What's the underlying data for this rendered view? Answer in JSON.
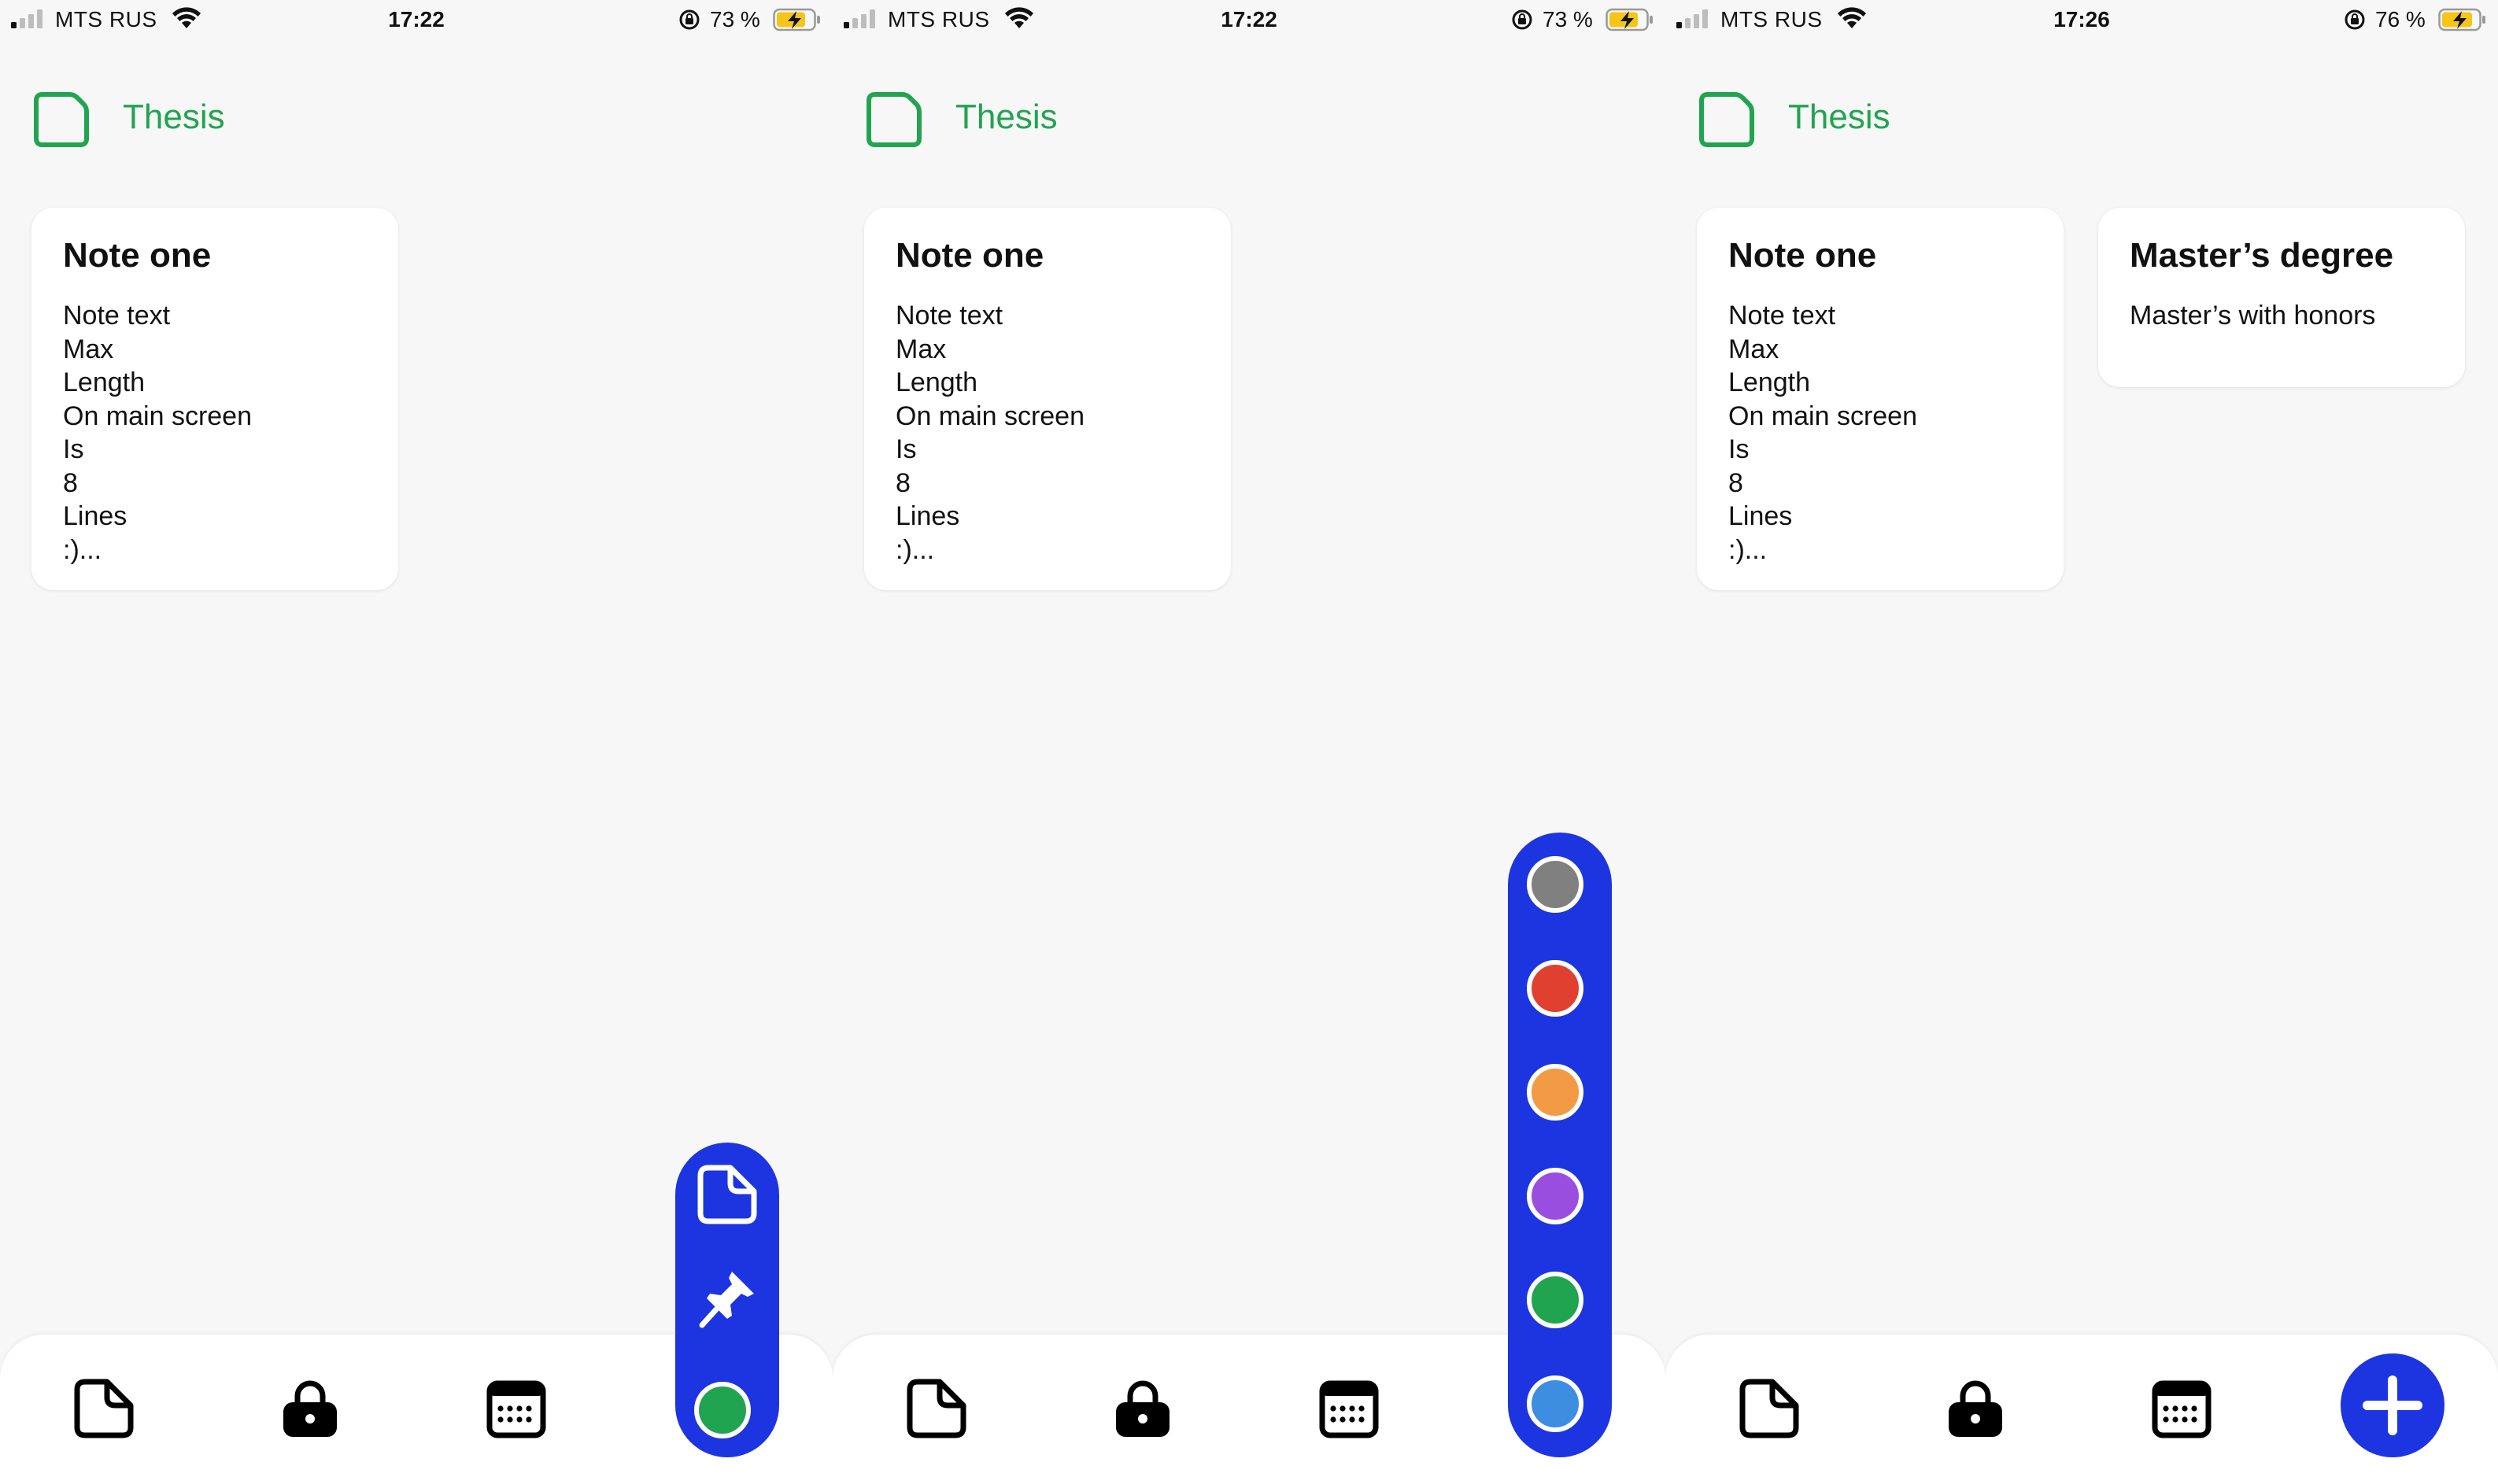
{
  "screens": [
    {
      "status": {
        "carrier": "MTS RUS",
        "time": "17:22",
        "battery": "73 %"
      },
      "folder_title": "Thesis",
      "notes": [
        {
          "title": "Note one",
          "lines": [
            "Note text",
            "Max",
            "Length",
            "On main screen",
            "Is",
            "8",
            "Lines",
            ":)..."
          ]
        }
      ],
      "menu": {
        "type": "actions",
        "items": [
          "note-icon",
          "pin-icon",
          "color-dot"
        ],
        "current_color": "#21a450"
      }
    },
    {
      "status": {
        "carrier": "MTS RUS",
        "time": "17:22",
        "battery": "73 %"
      },
      "folder_title": "Thesis",
      "notes": [
        {
          "title": "Note one",
          "lines": [
            "Note text",
            "Max",
            "Length",
            "On main screen",
            "Is",
            "8",
            "Lines",
            ":)..."
          ]
        }
      ],
      "menu": {
        "type": "colors",
        "colors": [
          {
            "name": "gray",
            "hex": "#808080"
          },
          {
            "name": "red",
            "hex": "#e0402f"
          },
          {
            "name": "orange",
            "hex": "#f39a45"
          },
          {
            "name": "purple",
            "hex": "#9a4ee0"
          },
          {
            "name": "green",
            "hex": "#21a450"
          },
          {
            "name": "blue",
            "hex": "#3d8ee0"
          }
        ]
      }
    },
    {
      "status": {
        "carrier": "MTS RUS",
        "time": "17:26",
        "battery": "76 %"
      },
      "folder_title": "Thesis",
      "notes": [
        {
          "title": "Note one",
          "lines": [
            "Note text",
            "Max",
            "Length",
            "On main screen",
            "Is",
            "8",
            "Lines",
            ":)..."
          ]
        },
        {
          "title": "Master’s degree",
          "lines": [
            "Master’s with honors"
          ]
        }
      ],
      "menu": {
        "type": "add-button"
      }
    }
  ],
  "tabs": [
    "notes-tab-icon",
    "lock-tab-icon",
    "calendar-tab-icon"
  ],
  "colors": {
    "accent": "#1c35e0",
    "folder_green": "#21a450",
    "background": "#f7f7f7"
  }
}
